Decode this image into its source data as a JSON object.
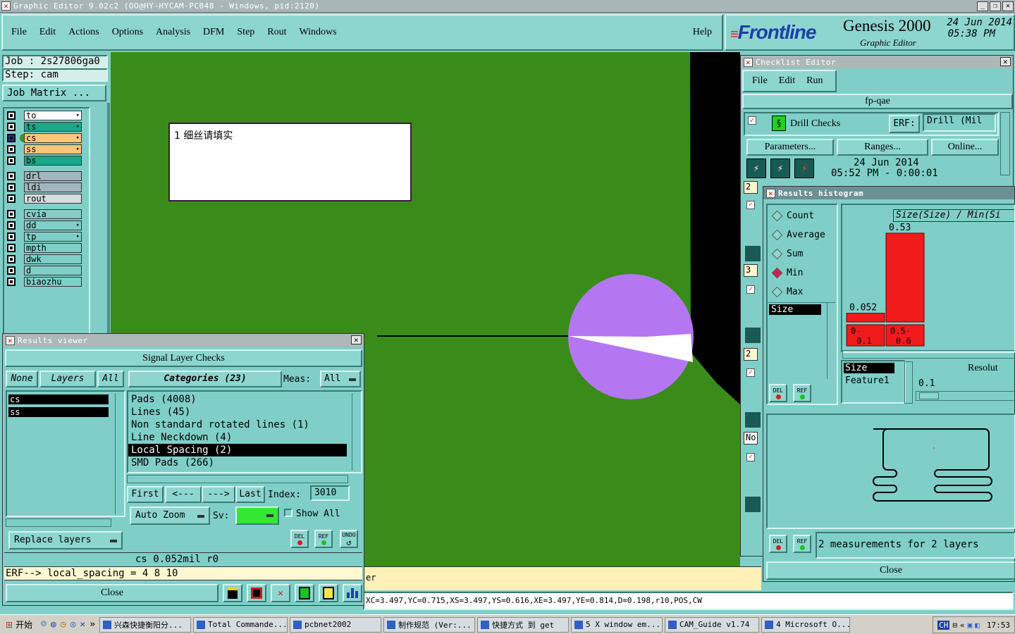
{
  "window_title": "Graphic Editor 9.02c2 (OO@HY-HYCAM-PC048 - Windows, pid:2120)",
  "menu": [
    "File",
    "Edit",
    "Actions",
    "Options",
    "Analysis",
    "DFM",
    "Step",
    "Rout",
    "Windows"
  ],
  "help": "Help",
  "brand": {
    "logo": "Frontline",
    "product": "Genesis 2000",
    "subtitle": "Graphic Editor",
    "date": "24 Jun 2014",
    "time": "05:38 PM"
  },
  "job": {
    "job_label": "Job : 2s27806ga0",
    "step_label": "Step: cam",
    "matrix_button": "Job Matrix ..."
  },
  "layers": [
    {
      "name": "to",
      "color": "#ffffff",
      "mark": "⬩"
    },
    {
      "name": "ts",
      "color": "#1aa88a",
      "mark": "⬩"
    },
    {
      "name": "cs",
      "color": "#f9c67a",
      "mark": "⬩"
    },
    {
      "name": "ss",
      "color": "#f9c67a",
      "mark": "⬩"
    },
    {
      "name": "bs",
      "color": "#1aa88a",
      "mark": ""
    },
    {
      "name": "drl",
      "color": "#a3b5bd",
      "mark": ""
    },
    {
      "name": "ldi",
      "color": "#a3b5bd",
      "mark": ""
    },
    {
      "name": "rout",
      "color": "#d9dcdc",
      "mark": ""
    },
    {
      "name": "cvia",
      "color": "#7fcfc8",
      "mark": ""
    },
    {
      "name": "dd",
      "color": "#7fcfc8",
      "mark": "⬩"
    },
    {
      "name": "tp",
      "color": "#7fcfc8",
      "mark": "⬩"
    },
    {
      "name": "mpth",
      "color": "#7fcfc8",
      "mark": ""
    },
    {
      "name": "dwk",
      "color": "#7fcfc8",
      "mark": ""
    },
    {
      "name": "d",
      "color": "#7fcfc8",
      "mark": ""
    },
    {
      "name": "biaozhu",
      "color": "#7fcfc8",
      "mark": ""
    }
  ],
  "note_text": "1 细丝请填实",
  "results_viewer": {
    "title": "Results viewer",
    "header": "Signal Layer Checks",
    "none_btn": "None",
    "layers_btn": "Layers",
    "all_btn": "All",
    "categories_btn": "Categories (23)",
    "meas_label": "Meas:",
    "meas_value": "All",
    "layer_list": [
      "cs",
      "ss"
    ],
    "categories": [
      "Pads (4008)",
      "Lines (45)",
      "Non standard rotated lines (1)",
      "Line Neckdown (4)",
      "Local Spacing (2)",
      "SMD Pads (266)"
    ],
    "selected_category": "Local Spacing (2)",
    "first": "First",
    "prev": "<---",
    "next": "--->",
    "last": "Last",
    "index_label": "Index:",
    "index_value": "3010",
    "autozoom": "Auto Zoom",
    "sv_label": "Sv:",
    "show_all": "Show All",
    "replace_layers": "Replace layers",
    "status": "cs 0.052mil   r0",
    "erf": "ERF--> local_spacing = 4 8 10",
    "close": "Close",
    "del": "DEL",
    "ref": "REF",
    "undo": "UNDO"
  },
  "checklist": {
    "title": "Checklist Editor",
    "menu": [
      "File",
      "Edit",
      "Run"
    ],
    "name": "fp-qae",
    "check_name": "Drill Checks",
    "erf_label": "ERF:",
    "erf_value": "Drill (Mil",
    "parameters": "Parameters...",
    "ranges": "Ranges...",
    "online": "Online...",
    "date": "24 Jun 2014",
    "time": "05:52 PM - 0:00:01",
    "row_nums": [
      "2",
      "3",
      "2",
      "No"
    ]
  },
  "histogram": {
    "title": "Results histogram",
    "options": [
      "Count",
      "Average",
      "Sum",
      "Min",
      "Max"
    ],
    "selected": "Min",
    "size_label": "Size",
    "chart_title": "Size(Size) / Min(Si",
    "bars": [
      {
        "label": "0-0.1",
        "value": 0.052
      },
      {
        "label": "0.5-0.6",
        "value": 0.53
      }
    ],
    "size_field": "Size",
    "feature_field": "Feature1",
    "resolution_label": "Resolut",
    "resolution_value": "0.1",
    "measurements": "2 measurements for 2 layers",
    "close": "Close"
  },
  "coords": "XC=3.497,YC=0.715,XS=3.497,YS=0.616,XE=3.497,YE=0.814,D=0.198,r10,POS,CW",
  "er_fragment": "er",
  "taskbar": {
    "start": "开始",
    "items": [
      "兴森快捷衡阳分...",
      "Total Commande...",
      "pcbnet2002",
      "制作规范 (Ver:...",
      "快捷方式 到 get",
      "5 X window em...",
      "CAM_Guide v1.74",
      "4 Microsoft O..."
    ],
    "ime": "CH",
    "clock": "17:53"
  }
}
